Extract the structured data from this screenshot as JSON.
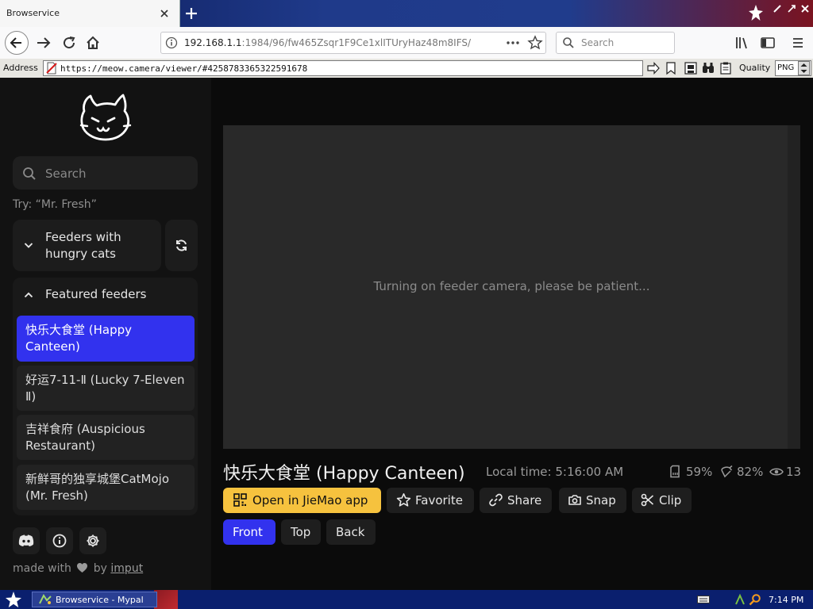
{
  "browser": {
    "tab_title": "Browservice",
    "url_host": "192.168.1.1",
    "url_rest": ":1984/96/fw465Zsqr1F9Ce1xlITUryHaz48m8IFS/",
    "search_placeholder": "Search",
    "address_label": "Address",
    "address_url": "https://meow.camera/viewer/#4258783365322591678",
    "quality_label": "Quality",
    "quality_value": "PNG"
  },
  "sidebar": {
    "search_placeholder": "Search",
    "try_hint": "Try: “Mr. Fresh”",
    "hungry_section": "Feeders with hungry cats",
    "featured_section": "Featured feeders",
    "feeders": [
      {
        "label": "快乐大食堂 (Happy Canteen)"
      },
      {
        "label": "好运7-11-Ⅱ (Lucky 7-Eleven Ⅱ)"
      },
      {
        "label": "吉祥食府 (Auspicious Restaurant)"
      },
      {
        "label": "新鲜哥的独享城堡CatMojo (Mr. Fresh)"
      }
    ],
    "made_with": "made with",
    "made_by": "by",
    "made_by_link": "imput"
  },
  "viewer": {
    "status": "Turning on feeder camera, please be patient...",
    "title": "快乐大食堂 (Happy Canteen)",
    "local_time": "Local time: 5:16:00 AM",
    "stat_storage": "59%",
    "stat_food": "82%",
    "stat_viewers": "13",
    "buttons": {
      "open_app": "Open in JieMao app",
      "favorite": "Favorite",
      "share": "Share",
      "snap": "Snap",
      "clip": "Clip"
    },
    "views": [
      "Front",
      "Top",
      "Back"
    ]
  },
  "taskbar": {
    "item_label": "Browservice - Mypal",
    "clock": "7:14 PM"
  },
  "colors": {
    "accent": "#3232ee",
    "open_app": "#f6c23e",
    "sidebar": "#121212",
    "video": "#292929"
  }
}
